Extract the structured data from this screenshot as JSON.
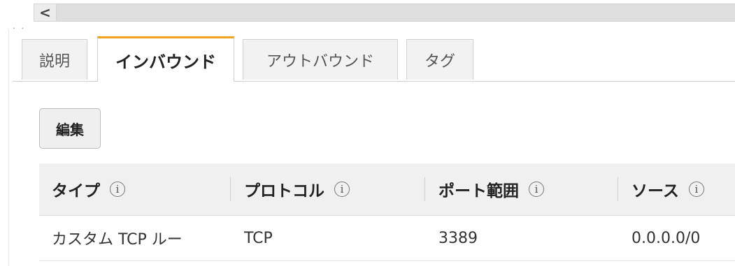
{
  "scrollbar": {
    "left_arrow": "<"
  },
  "tabs": [
    {
      "label": "説明"
    },
    {
      "label": "インバウンド"
    },
    {
      "label": "アウトバウンド"
    },
    {
      "label": "タグ"
    }
  ],
  "edit_button": "編集",
  "table": {
    "info_icon": "i",
    "headers": [
      "タイプ",
      "プロトコル",
      "ポート範囲",
      "ソース"
    ],
    "rows": [
      [
        "カスタム TCP ルー",
        "TCP",
        "3389",
        "0.0.0.0/0"
      ]
    ]
  },
  "colors": {
    "active_tab_accent": "#f0a21b"
  }
}
